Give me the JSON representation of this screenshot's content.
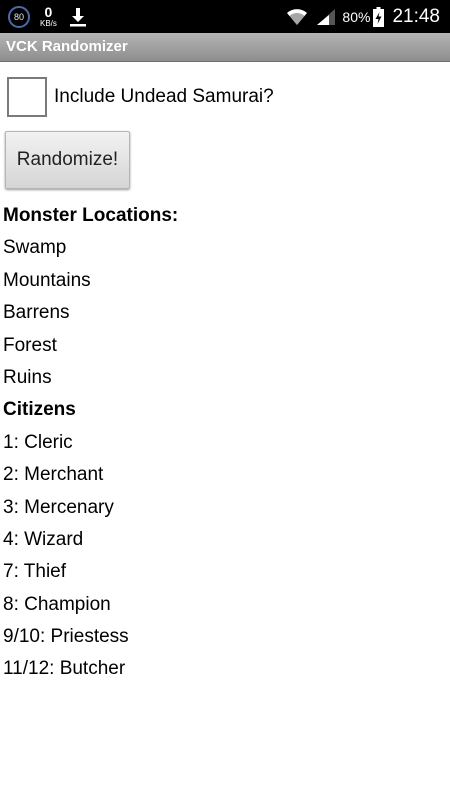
{
  "status_bar": {
    "notification_badge": "80",
    "net_speed_value": "0",
    "net_speed_unit": "KB/s",
    "battery_percent": "80%",
    "time": "21:48",
    "icons": [
      "download-icon",
      "wifi-icon",
      "signal-icon",
      "battery-charging-icon"
    ]
  },
  "app": {
    "title": "VCK Randomizer"
  },
  "options": {
    "undead_samurai_label": "Include Undead Samurai?",
    "undead_samurai_checked": false
  },
  "actions": {
    "randomize_label": "Randomize!"
  },
  "monster_locations": {
    "heading": "Monster Locations:",
    "items": [
      "Swamp",
      "Mountains",
      "Barrens",
      "Forest",
      "Ruins"
    ]
  },
  "citizens": {
    "heading": "Citizens",
    "items": [
      "1: Cleric",
      "2: Merchant",
      "3: Mercenary",
      "4: Wizard",
      "7: Thief",
      "8: Champion",
      "9/10: Priestess",
      "11/12: Butcher"
    ]
  }
}
